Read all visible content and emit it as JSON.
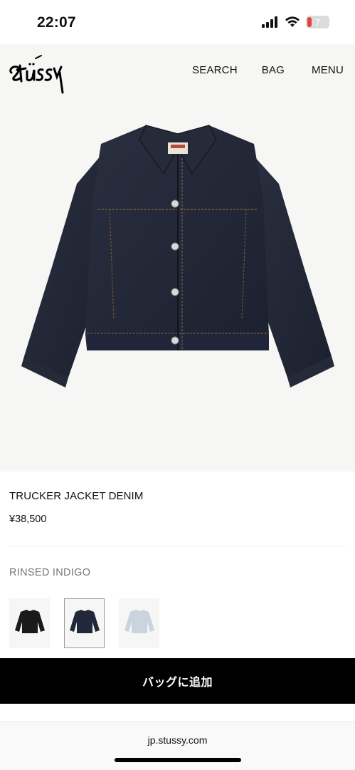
{
  "status_bar": {
    "time": "22:07",
    "battery_level": "7"
  },
  "header": {
    "logo_text": "Stüssy",
    "nav": {
      "search": "SEARCH",
      "bag": "BAG",
      "menu": "MENU"
    }
  },
  "hero": {
    "image": "trucker-jacket-denim-rinsed-indigo"
  },
  "product": {
    "title": "TRUCKER JACKET DENIM",
    "price": "¥38,500",
    "color_name": "RINSED INDIGO",
    "swatches": [
      {
        "image": "jacket-black",
        "color": "#1a1a1a"
      },
      {
        "image": "jacket-rinsed-indigo",
        "color": "#20283a",
        "selected": true
      },
      {
        "image": "jacket-light-wash",
        "color": "#c9d4de"
      }
    ]
  },
  "add_to_bag_label": "バッグに追加",
  "browser": {
    "url": "jp.stussy.com"
  },
  "colors": {
    "accent": "#000000",
    "background": "#f6f6f4",
    "muted_text": "#777777"
  }
}
